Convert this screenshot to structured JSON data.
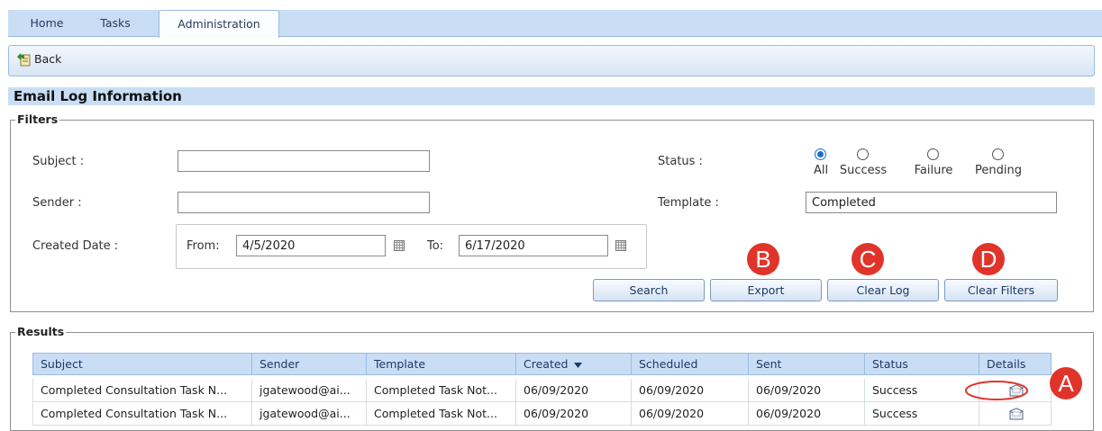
{
  "tabs": [
    "Home",
    "Tasks",
    "Administration"
  ],
  "toolbar": {
    "back_label": "Back"
  },
  "section_title": "Email Log Information",
  "filters": {
    "legend": "Filters",
    "subject_label": "Subject :",
    "subject_value": "",
    "sender_label": "Sender :",
    "sender_value": "",
    "created_label": "Created Date :",
    "from_label": "From:",
    "from_value": "4/5/2020",
    "to_label": "To:",
    "to_value": "6/17/2020",
    "status_label": "Status :",
    "status_options": [
      "All",
      "Success",
      "Failure",
      "Pending"
    ],
    "status_selected": "All",
    "template_label": "Template :",
    "template_value": "Completed"
  },
  "buttons": {
    "search": "Search",
    "export": "Export",
    "clear_log": "Clear Log",
    "clear_filters": "Clear Filters"
  },
  "markers": [
    "A",
    "B",
    "C",
    "D"
  ],
  "results": {
    "legend": "Results",
    "columns": [
      "Subject",
      "Sender",
      "Template",
      "Created",
      "Scheduled",
      "Sent",
      "Status",
      "Details"
    ],
    "sort_column": "Created",
    "sort_direction": "descending",
    "rows": [
      [
        "Completed Consultation Task N...",
        "jgatewood@ai...",
        "Completed Task Not...",
        "06/09/2020",
        "06/09/2020",
        "06/09/2020",
        "Success"
      ],
      [
        "Completed Consultation Task N...",
        "jgatewood@ai...",
        "Completed Task Not...",
        "06/09/2020",
        "06/09/2020",
        "06/09/2020",
        "Success"
      ]
    ]
  },
  "colors": {
    "header_blue": "#c9ddf5",
    "marker_red": "#e0342b",
    "radio_selected": "#1a6fd6"
  },
  "icons": [
    "back-icon",
    "calendar-icon",
    "sort-desc-icon",
    "details-envelope-icon"
  ]
}
